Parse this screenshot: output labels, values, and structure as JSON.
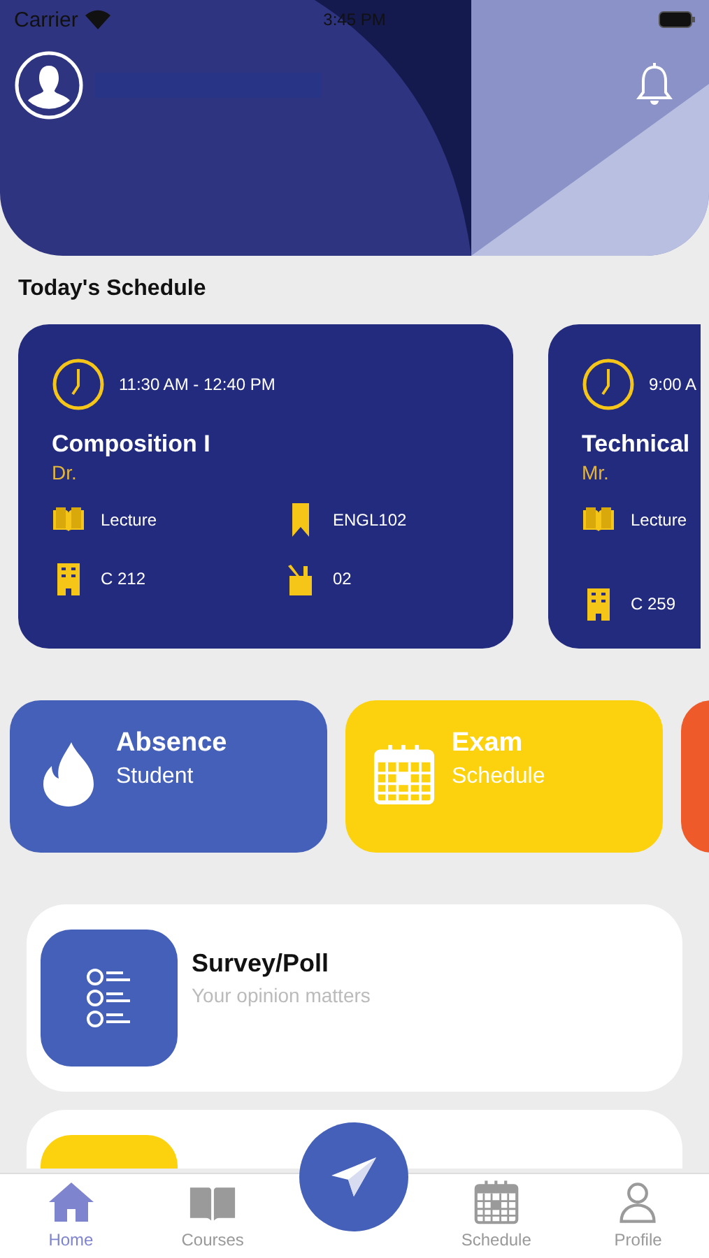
{
  "status_bar": {
    "carrier": "Carrier",
    "time": "3:45 PM"
  },
  "section_title": "Today's Schedule",
  "schedule_cards": [
    {
      "time": "11:30 AM - 12:40 PM",
      "title": "Composition I",
      "teacher": "Dr.",
      "type": "Lecture",
      "code": "ENGL102",
      "room": "C 212",
      "section": "02"
    },
    {
      "time": "9:00 A",
      "title": "Technical",
      "teacher": "Mr.",
      "type": "Lecture",
      "room": "C 259"
    }
  ],
  "tiles": [
    {
      "kind": "flame",
      "title": "Absence",
      "subtitle": "Student",
      "color": "#4560b8"
    },
    {
      "kind": "calendar",
      "title": "Exam",
      "subtitle": "Schedule",
      "color": "#fcd20e"
    },
    {
      "kind": "blank",
      "color": "#ee5a2a"
    }
  ],
  "list_cards": [
    {
      "title": "Survey/Poll",
      "subtitle": "Your opinion matters",
      "color": "#4560b8"
    },
    {
      "color": "#fcd20e"
    }
  ],
  "tab_bar": [
    {
      "kind": "home",
      "label": "Home",
      "selected": true
    },
    {
      "kind": "book",
      "label": "Courses",
      "selected": false
    },
    {
      "kind": "calendar",
      "label": "Schedule",
      "selected": false
    },
    {
      "kind": "person",
      "label": "Profile",
      "selected": false
    }
  ]
}
